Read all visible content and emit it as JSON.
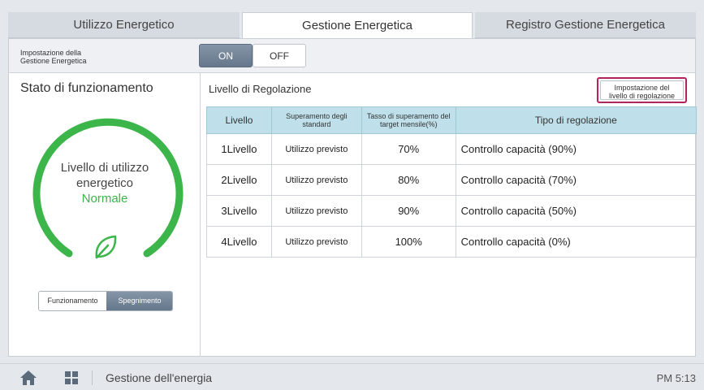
{
  "tabs": [
    {
      "label": "Utilizzo Energetico"
    },
    {
      "label": "Gestione Energetica"
    },
    {
      "label": "Registro Gestione Energetica"
    }
  ],
  "setting": {
    "label_line1": "Impostazione della",
    "label_line2": "Gestione Energetica",
    "on_label": "ON",
    "off_label": "OFF",
    "selected": "ON"
  },
  "left": {
    "title": "Stato di funzionamento",
    "ring_line1": "Livello di utilizzo",
    "ring_line2": "energetico",
    "status": "Normale",
    "toggle": {
      "option_a": "Funzionamento",
      "option_b": "Spegnimento",
      "selected": "Spegnimento"
    }
  },
  "right": {
    "title": "Livello di Regolazione",
    "adjust_button_line1": "Impostazione del",
    "adjust_button_line2": "livello di regolazione",
    "table": {
      "headers": {
        "level": "Livello",
        "standard": "Superamento degli standard",
        "rate": "Tasso di superamento del target mensile(%)",
        "type": "Tipo di regolazione"
      },
      "rows": [
        {
          "level": "1Livello",
          "standard": "Utilizzo previsto",
          "rate": "70%",
          "type": "Controllo capacità (90%)"
        },
        {
          "level": "2Livello",
          "standard": "Utilizzo previsto",
          "rate": "80%",
          "type": "Controllo capacità (70%)"
        },
        {
          "level": "3Livello",
          "standard": "Utilizzo previsto",
          "rate": "90%",
          "type": "Controllo capacità (50%)"
        },
        {
          "level": "4Livello",
          "standard": "Utilizzo previsto",
          "rate": "100%",
          "type": "Controllo capacità (0%)"
        }
      ]
    }
  },
  "bottom": {
    "title": "Gestione dell'energia",
    "clock": "PM 5:13"
  },
  "colors": {
    "accent": "#3cb54a",
    "highlight_border": "#b3245e",
    "table_header": "#bfe0ea"
  },
  "icons": [
    "home-icon",
    "grid-icon",
    "leaf-icon"
  ]
}
